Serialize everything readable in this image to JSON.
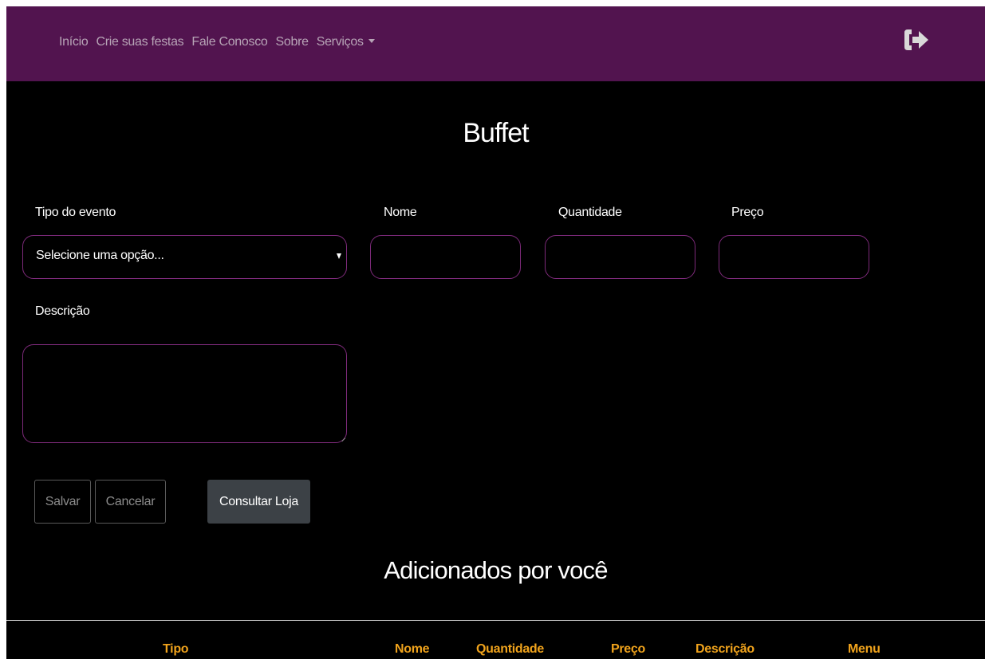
{
  "navbar": {
    "links": [
      "Início",
      "Crie suas festas",
      "Fale Conosco",
      "Sobre"
    ],
    "services_label": "Serviços",
    "logout_icon": "sign-out-icon",
    "bg_color": "#52144f"
  },
  "page": {
    "title": "Buffet",
    "added_title": "Adicionados por você"
  },
  "form": {
    "event_type_label": "Tipo do evento",
    "event_type_value": "Selecione uma opção...",
    "name_label": "Nome",
    "quantity_label": "Quantidade",
    "price_label": "Preço",
    "description_label": "Descrição"
  },
  "buttons": {
    "save": "Salvar",
    "cancel": "Cancelar",
    "consult": "Consultar Loja"
  },
  "table": {
    "headers": [
      "Tipo",
      "Nome",
      "Quantidade",
      "Preço",
      "Descrição",
      "Menu"
    ],
    "header_color": "#f0a31c"
  }
}
